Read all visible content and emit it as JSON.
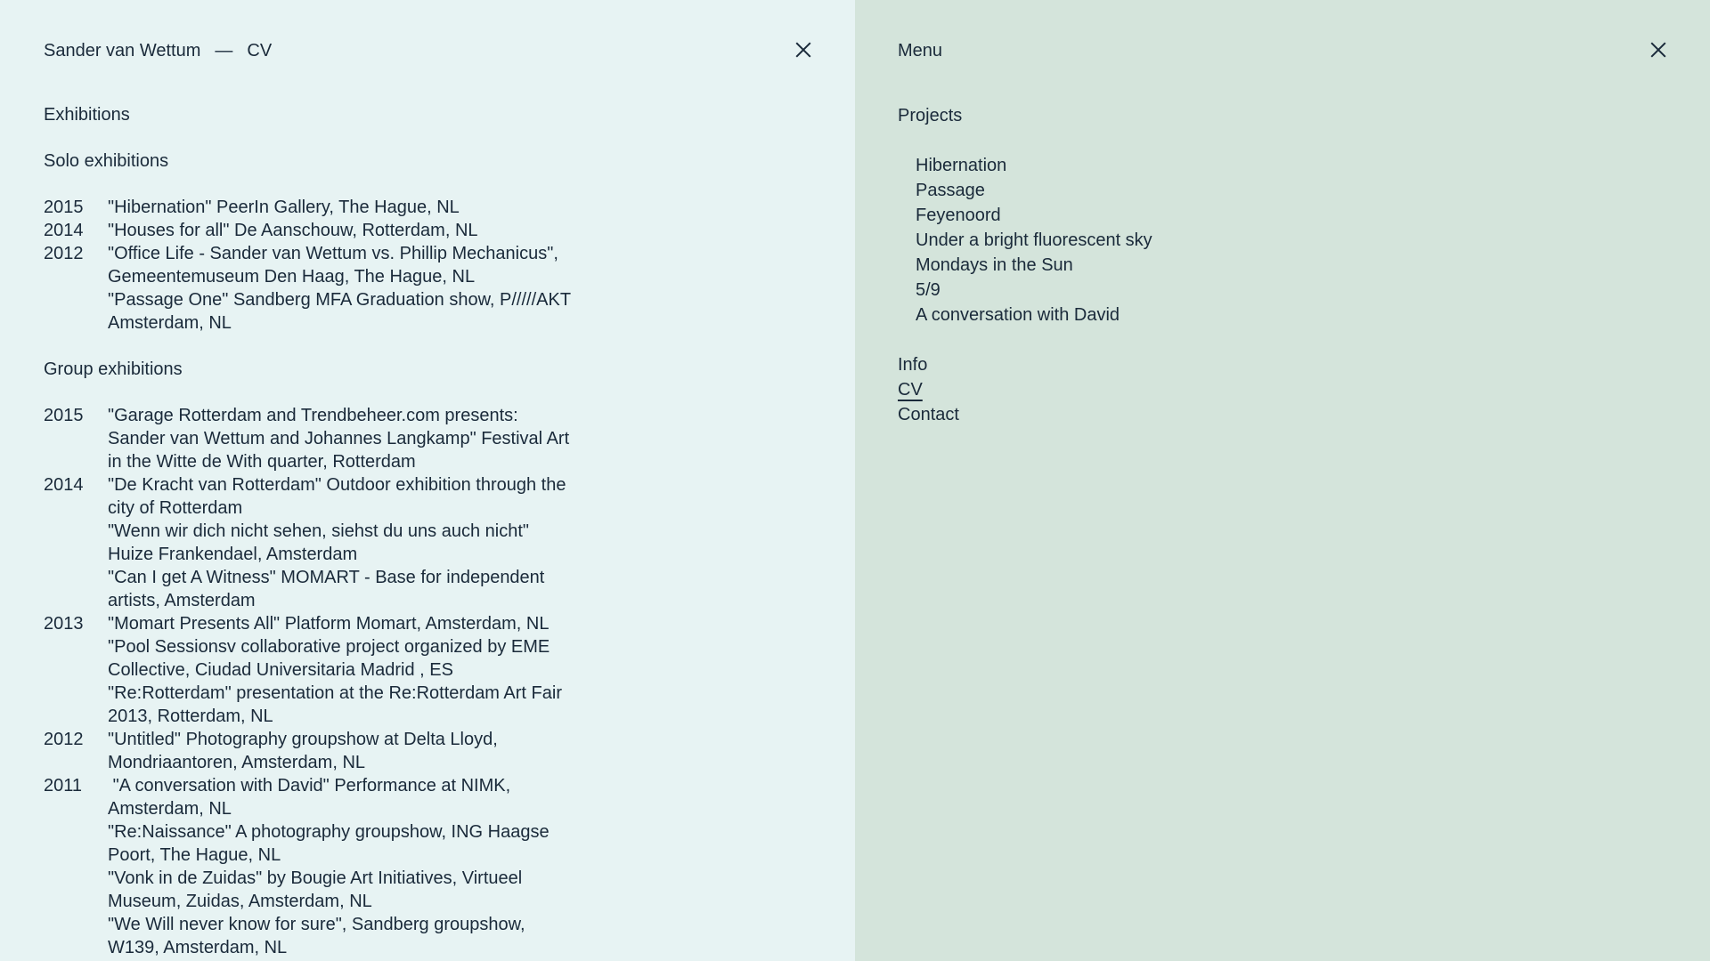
{
  "header": {
    "name": "Sander van Wettum",
    "separator": "—",
    "page": "CV"
  },
  "cv": {
    "section_title": "Exhibitions",
    "solo": {
      "title": "Solo exhibitions",
      "rows": [
        {
          "year": "2015",
          "entries": [
            "\"Hibernation\" PeerIn Gallery, The Hague, NL"
          ]
        },
        {
          "year": "2014",
          "entries": [
            "\"Houses for all\" De Aanschouw, Rotterdam, NL"
          ]
        },
        {
          "year": "2012",
          "entries": [
            "\"Office Life - Sander van Wettum vs. Phillip Mechanicus\", Gemeentemuseum Den Haag, The Hague, NL",
            "\"Passage One\" Sandberg MFA Graduation show, P/////AKT  Amsterdam, NL"
          ]
        }
      ]
    },
    "group": {
      "title": "Group exhibitions",
      "rows": [
        {
          "year": "2015",
          "entries": [
            "\"Garage Rotterdam and Trendbeheer.com presents: Sander van Wettum and Johannes Langkamp\" Festival Art in the Witte de With quarter, Rotterdam"
          ]
        },
        {
          "year": "2014",
          "entries": [
            "\"De Kracht van Rotterdam\" Outdoor exhibition through the city of Rotterdam",
            "\"Wenn wir dich nicht sehen, siehst du uns auch nicht\" Huize Frankendael, Amsterdam",
            "\"Can I get A Witness\" MOMART - Base for independent artists, Amsterdam"
          ]
        },
        {
          "year": "2013",
          "entries": [
            "\"Momart Presents All\" Platform Momart, Amsterdam, NL",
            "\"Pool Sessionsv collaborative project organized by EME Collective, Ciudad Universitaria Madrid , ES",
            "\"Re:Rotterdam\" presentation at the Re:Rotterdam Art Fair 2013, Rotterdam, NL"
          ]
        },
        {
          "year": "2012",
          "entries": [
            "\"Untitled\" Photography groupshow at Delta Lloyd,  Mondriaantoren, Amsterdam, NL"
          ]
        },
        {
          "year": "2011",
          "entries": [
            " \"A conversation with David\" Performance at NIMK, Amsterdam, NL",
            "\"Re:Naissance\" A photography groupshow, ING Haagse Poort, The Hague, NL",
            "\"Vonk in de Zuidas\" by Bougie Art Initiatives, Virtueel Museum, Zuidas, Amsterdam, NL",
            "\"We Will never know for sure\", Sandberg groupshow, W139, Amsterdam, NL"
          ]
        }
      ]
    }
  },
  "menu": {
    "title": "Menu",
    "projects_label": "Projects",
    "projects": [
      "Hibernation",
      "Passage",
      "Feyenoord",
      "Under a bright fluorescent sky",
      "Mondays in the Sun",
      "5/9",
      "A conversation with David"
    ],
    "links": [
      {
        "label": "Info",
        "active": false
      },
      {
        "label": "CV",
        "active": true
      },
      {
        "label": "Contact",
        "active": false
      }
    ]
  },
  "colors": {
    "left_bg": "#e7f3f3",
    "right_bg": "#d4e4db",
    "text": "#1a2a3a"
  },
  "icons": {
    "close": "close-icon"
  }
}
